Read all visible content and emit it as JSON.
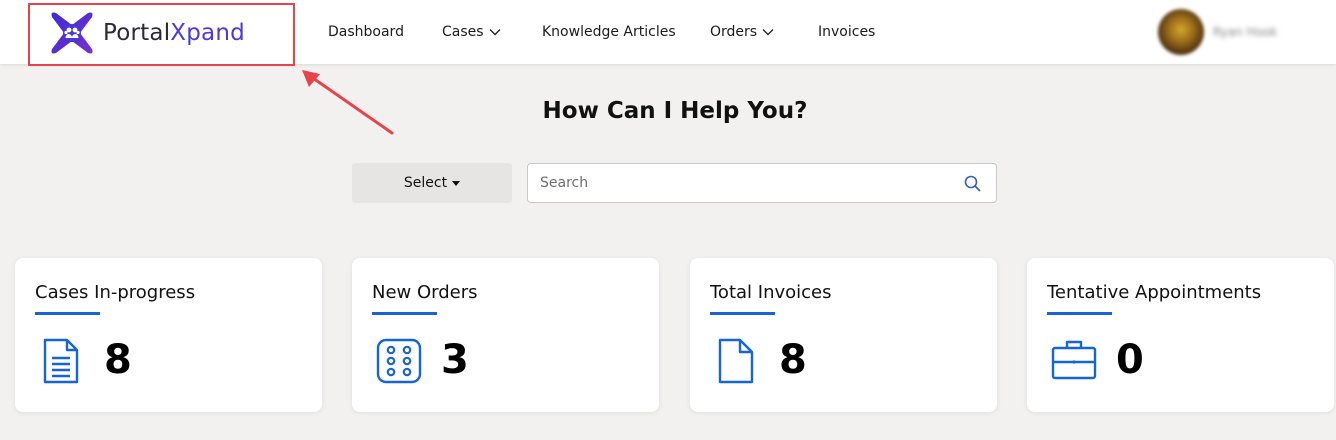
{
  "brand": {
    "name_part1": "Portal",
    "name_part2": "Xpand"
  },
  "nav": {
    "items": [
      {
        "label": "Dashboard",
        "has_dropdown": false
      },
      {
        "label": "Cases",
        "has_dropdown": true
      },
      {
        "label": "Knowledge Articles",
        "has_dropdown": false
      },
      {
        "label": "Orders",
        "has_dropdown": true
      },
      {
        "label": "Invoices",
        "has_dropdown": false
      }
    ]
  },
  "user": {
    "name": "Ryan Hook",
    "avatar_icon": "user-avatar"
  },
  "hero": {
    "title": "How Can I Help You?",
    "select_label": "Select",
    "search_placeholder": "Search"
  },
  "cards": [
    {
      "title": "Cases In-progress",
      "value": "8",
      "icon": "document-lines-icon"
    },
    {
      "title": "New Orders",
      "value": "3",
      "icon": "dice-six-icon"
    },
    {
      "title": "Total Invoices",
      "value": "8",
      "icon": "blank-file-icon"
    },
    {
      "title": "Tentative Appointments",
      "value": "0",
      "icon": "briefcase-icon"
    }
  ],
  "colors": {
    "accent": "#1565d6",
    "annotation_red": "#e8434a",
    "page_bg": "#f2f1f0",
    "brand_purple": "#4a3ad8"
  }
}
